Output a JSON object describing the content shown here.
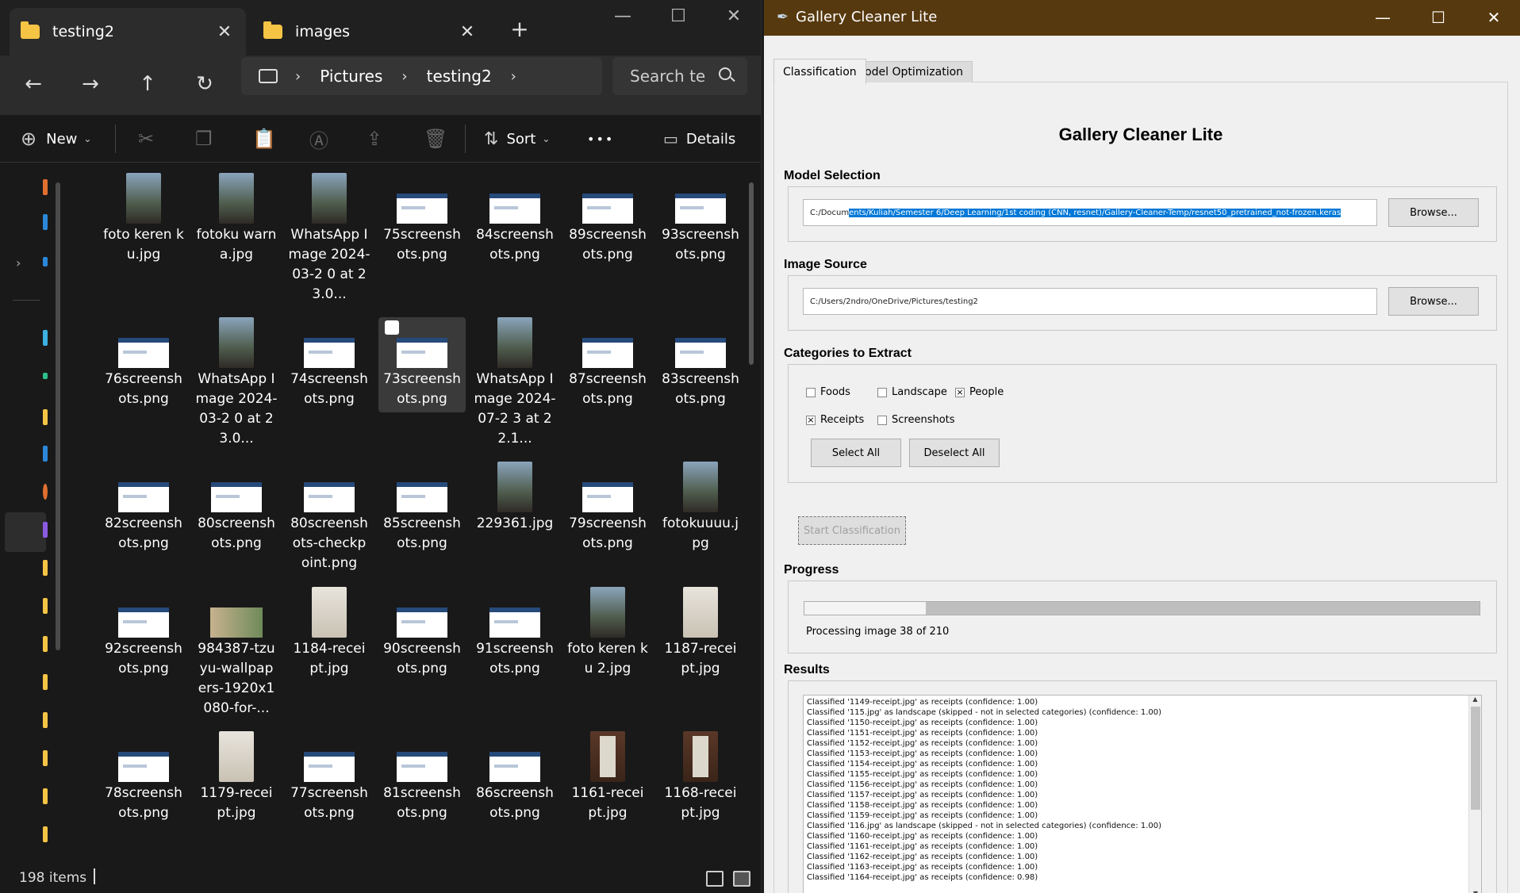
{
  "explorer": {
    "tabs": [
      {
        "label": "testing2",
        "close": "✕"
      },
      {
        "label": "images",
        "close": "✕"
      }
    ],
    "new_tab": "+",
    "window_buttons": {
      "minimize": "—",
      "maximize": "☐",
      "close": "✕"
    },
    "nav": {
      "back": "←",
      "forward": "→",
      "up": "↑",
      "refresh": "↻"
    },
    "breadcrumb": [
      "Pictures",
      "testing2"
    ],
    "breadcrumb_sep": "›",
    "search_placeholder": "Search te",
    "commands": {
      "new": "New",
      "sort": "Sort",
      "more": "•••",
      "details": "Details"
    },
    "items": [
      {
        "name": "foto keren ku.jpg",
        "kind": "photo"
      },
      {
        "name": "fotoku warna.jpg",
        "kind": "photo"
      },
      {
        "name": "WhatsApp Image 2024-03-2 0 at 23.0...",
        "kind": "photo"
      },
      {
        "name": "75screensh ots.png",
        "kind": "shot"
      },
      {
        "name": "84screensh ots.png",
        "kind": "shot"
      },
      {
        "name": "89screensh ots.png",
        "kind": "shot"
      },
      {
        "name": "93screensh ots.png",
        "kind": "shot"
      },
      {
        "name": "76screensh ots.png",
        "kind": "shot"
      },
      {
        "name": "WhatsApp Image 2024-03-2 0 at 23.0...",
        "kind": "photo"
      },
      {
        "name": "74screensh ots.png",
        "kind": "shot"
      },
      {
        "name": "73screensh ots.png",
        "kind": "shot",
        "selected": true
      },
      {
        "name": "WhatsApp Image 2024-07-2 3 at 22.1...",
        "kind": "photo"
      },
      {
        "name": "87screensh ots.png",
        "kind": "shot"
      },
      {
        "name": "83screensh ots.png",
        "kind": "shot"
      },
      {
        "name": "82screensh ots.png",
        "kind": "shot"
      },
      {
        "name": "80screensh ots.png",
        "kind": "shot"
      },
      {
        "name": "80screensh ots-checkp oint.png",
        "kind": "shot"
      },
      {
        "name": "85screensh ots.png",
        "kind": "shot"
      },
      {
        "name": "229361.jpg",
        "kind": "photo"
      },
      {
        "name": "79screensh ots.png",
        "kind": "shot"
      },
      {
        "name": "fotokuuuu.j pg",
        "kind": "photo"
      },
      {
        "name": "92screensh ots.png",
        "kind": "shot"
      },
      {
        "name": "984387-tzu yu-wallpap ers-1920x1 080-for-...",
        "kind": "wide"
      },
      {
        "name": "1184-recei pt.jpg",
        "kind": "rec"
      },
      {
        "name": "90screensh ots.png",
        "kind": "shot"
      },
      {
        "name": "91screensh ots.png",
        "kind": "shot"
      },
      {
        "name": "foto keren ku 2.jpg",
        "kind": "photo"
      },
      {
        "name": "1187-recei pt.jpg",
        "kind": "rec"
      },
      {
        "name": "78screensh ots.png",
        "kind": "shot"
      },
      {
        "name": "1179-recei pt.jpg",
        "kind": "rec"
      },
      {
        "name": "77screensh ots.png",
        "kind": "shot"
      },
      {
        "name": "81screensh ots.png",
        "kind": "shot"
      },
      {
        "name": "86screensh ots.png",
        "kind": "shot"
      },
      {
        "name": "1161-recei pt.jpg",
        "kind": "recd"
      },
      {
        "name": "1168-recei pt.jpg",
        "kind": "recd"
      }
    ],
    "status": "198 items"
  },
  "gallery": {
    "window_title": "Gallery Cleaner Lite",
    "window_buttons": {
      "minimize": "—",
      "maximize": "☐",
      "close": "✕"
    },
    "tabs": [
      "Classification",
      "Model Optimization"
    ],
    "app_title": "Gallery Cleaner Lite",
    "model": {
      "label": "Model Selection",
      "path_prefix": "C:/Docum",
      "path_selected": "ents/Kuliah/Semester 6/Deep Learning/1st coding (CNN, resnet)/Gallery-Cleaner-Temp/resnet50_pretrained_not-frozen.keras",
      "browse": "Browse..."
    },
    "source": {
      "label": "Image Source",
      "path": "C:/Users/2ndro/OneDrive/Pictures/testing2",
      "browse": "Browse..."
    },
    "categories": {
      "label": "Categories to Extract",
      "items": [
        {
          "name": "Foods",
          "checked": false
        },
        {
          "name": "Landscape",
          "checked": false
        },
        {
          "name": "People",
          "checked": true
        },
        {
          "name": "Receipts",
          "checked": true
        },
        {
          "name": "Screenshots",
          "checked": false
        }
      ],
      "check_mark": "×",
      "select_all": "Select All",
      "deselect_all": "Deselect All"
    },
    "start_button": "Start Classification",
    "progress": {
      "label": "Progress",
      "text": "Processing image 38 of 210",
      "value": 0.18
    },
    "results": {
      "label": "Results",
      "lines": [
        "Classified '1149-receipt.jpg' as receipts (confidence: 1.00)",
        "Classified '115.jpg' as landscape (skipped - not in selected categories) (confidence: 1.00)",
        "Classified '1150-receipt.jpg' as receipts (confidence: 1.00)",
        "Classified '1151-receipt.jpg' as receipts (confidence: 1.00)",
        "Classified '1152-receipt.jpg' as receipts (confidence: 1.00)",
        "Classified '1153-receipt.jpg' as receipts (confidence: 1.00)",
        "Classified '1154-receipt.jpg' as receipts (confidence: 1.00)",
        "Classified '1155-receipt.jpg' as receipts (confidence: 1.00)",
        "Classified '1156-receipt.jpg' as receipts (confidence: 1.00)",
        "Classified '1157-receipt.jpg' as receipts (confidence: 1.00)",
        "Classified '1158-receipt.jpg' as receipts (confidence: 1.00)",
        "Classified '1159-receipt.jpg' as receipts (confidence: 1.00)",
        "Classified '116.jpg' as landscape (skipped - not in selected categories) (confidence: 1.00)",
        "Classified '1160-receipt.jpg' as receipts (confidence: 1.00)",
        "Classified '1161-receipt.jpg' as receipts (confidence: 1.00)",
        "Classified '1162-receipt.jpg' as receipts (confidence: 1.00)",
        "Classified '1163-receipt.jpg' as receipts (confidence: 1.00)",
        "Classified '1164-receipt.jpg' as receipts (confidence: 0.98)"
      ]
    }
  },
  "colors": {
    "explorer_bg": "#191919",
    "gc_titlebar": "#57390f",
    "selection_blue": "#0078d7"
  }
}
